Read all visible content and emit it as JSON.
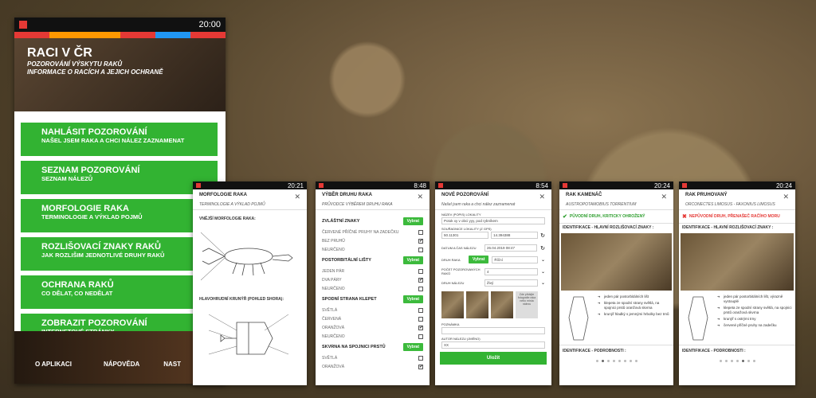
{
  "status_time_main": "20:00",
  "colors": {
    "stripe": [
      "#e53935",
      "#ff9800",
      "#ff9800",
      "#e53935",
      "#2196f3",
      "#e53935"
    ],
    "green": "#32b332",
    "red": "#e53935"
  },
  "main": {
    "title": "RACI V ČR",
    "sub1": "POZOROVÁNÍ VÝSKYTU RAKŮ",
    "sub2": "INFORMACE O RACÍCH A JEJICH OCHRANĚ",
    "buttons": [
      {
        "title": "NAHLÁSIT POZOROVÁNÍ",
        "sub": "NAŠEL JSEM RAKA A CHCI NÁLEZ ZAZNAMENAT"
      },
      {
        "title": "SEZNAM POZOROVÁNÍ",
        "sub": "SEZNAM NÁLEZŮ"
      },
      {
        "title": "MORFOLOGIE RAKA",
        "sub": "TERMINOLOGIE A VÝKLAD POJMŮ"
      },
      {
        "title": "ROZLIŠOVACÍ ZNAKY RAKŮ",
        "sub": "JAK ROZLIŠIM JEDNOTLIVÉ DRUHY RAKŮ"
      },
      {
        "title": "OCHRANA RAKŮ",
        "sub": "CO DĚLAT, CO NEDĚLAT"
      },
      {
        "title": "ZOBRAZIT POZOROVÁNÍ",
        "sub": "INTERNETOVÉ STRÁNKY"
      }
    ],
    "footer": [
      "O APLIKACI",
      "NÁPOVĚDA",
      "NAST"
    ]
  },
  "s1": {
    "time": "20:21",
    "title": "MORFOLOGIE RAKA",
    "sub": "TERMINOLOGIE A VÝKLAD POJMŮ",
    "h1": "VNĚJŠÍ MORFOLOGIE RAKA:",
    "h2": "HLAVOHRUDNÍ KRUNÝŘ (POHLED SHORA):"
  },
  "s2": {
    "time": "8:48",
    "title": "VÝBĚR DRUHU RAKA",
    "sub": "PRŮVODCE VÝBĚREM DRUHU RAKA",
    "btn": "Vybrat",
    "sections": [
      {
        "name": "ZVLÁŠTNÍ ZNAKY",
        "rows": [
          [
            "ČERVENÉ PŘÍČNÉ PRUHY NA ZADEČKU",
            false
          ],
          [
            "BEZ PRUHŮ",
            true
          ],
          [
            "NEURČENO",
            false
          ]
        ]
      },
      {
        "name": "POSTORBITÁLNÍ LIŠTY",
        "rows": [
          [
            "JEDEN PÁR",
            false
          ],
          [
            "DVA PÁRY",
            true
          ],
          [
            "NEURČENO",
            false
          ]
        ]
      },
      {
        "name": "SPODNÍ STRANA KLEPET",
        "rows": [
          [
            "SVĚTLÁ",
            false
          ],
          [
            "ČERVENÁ",
            false
          ],
          [
            "ORANŽOVÁ",
            true
          ],
          [
            "NEURČENO",
            false
          ]
        ]
      },
      {
        "name": "SKVRNA NA SPOJNICI PRSTŮ",
        "rows": [
          [
            "SVĚTLÁ",
            false
          ],
          [
            "ORANŽOVÁ",
            true
          ]
        ]
      }
    ]
  },
  "s3": {
    "time": "8:54",
    "title": "NOVÉ POZOROVÁNÍ",
    "sub": "Našel jsem raka a chci nález zaznamenat",
    "l1": "NÁZEV (POPIS) LOKALITY",
    "v1": "Potok xy v obci yyy, pod rybníkem",
    "l2": "SOUŘADNICE LOKALITY (Z GPS)",
    "lat": "50.11301",
    "lon": "14.394388",
    "l3": "DATUM A ČAS NÁLEZU",
    "date": "26.04.2019 08:47",
    "l4": "DRUH RAKA",
    "btn": "Vybrat",
    "sel": "Říční",
    "l5": "POČET POZOROVANÝCH RAKŮ",
    "cnt": "4",
    "l6": "DRUH NÁLEZU",
    "kind": "Živý",
    "photo_label": "Zde přidejte fotografie raka nebo místa nálezu",
    "l7": "POZNÁMKA",
    "l8": "AUTOR NÁLEZU (JMÉNO)",
    "author": "XX",
    "save": "Uložit"
  },
  "s4": {
    "time": "20:24",
    "title": "RAK KAMENÁČ",
    "latin": "AUSTROPOTAMOBIUS TORRENTIUM",
    "status": "PŮVODNÍ DRUH, KRITICKY OHROŽENÝ",
    "ident": "IDENTIFIKACE - HLAVNÍ ROZLIŠOVACÍ ZNAKY :",
    "bullets": [
      "jeden pár postorbitálních lišt",
      "klepeta ze spodní strany světlá, na spojnici prstů oranžová skvrna",
      "krunýř hladký s jemnými hrbolky bez trnů"
    ],
    "more": "IDENTIFIKACE - PODROBNOSTI :"
  },
  "s5": {
    "time": "20:24",
    "title": "RAK PRUHOVANÝ",
    "latin": "ORCONECTES LIMOSUS - FAXONIUS LIMOSUS",
    "status": "NEPŮVODNÍ DRUH, PŘENAŠEČ RAČÍHO MORU",
    "ident": "IDENTIFIKACE - HLAVNÍ ROZLIŠOVACÍ ZNAKY :",
    "bullets": [
      "jeden pár postorbitálních lišt, výrazně vystouplé",
      "klepeta ze spodní strany světlá, na spojnici prstů oranžová skvrna",
      "krunýř s ostrými trny",
      "červené příčné pruhy na zadečku"
    ],
    "more": "IDENTIFIKACE - PODROBNOSTI :"
  }
}
